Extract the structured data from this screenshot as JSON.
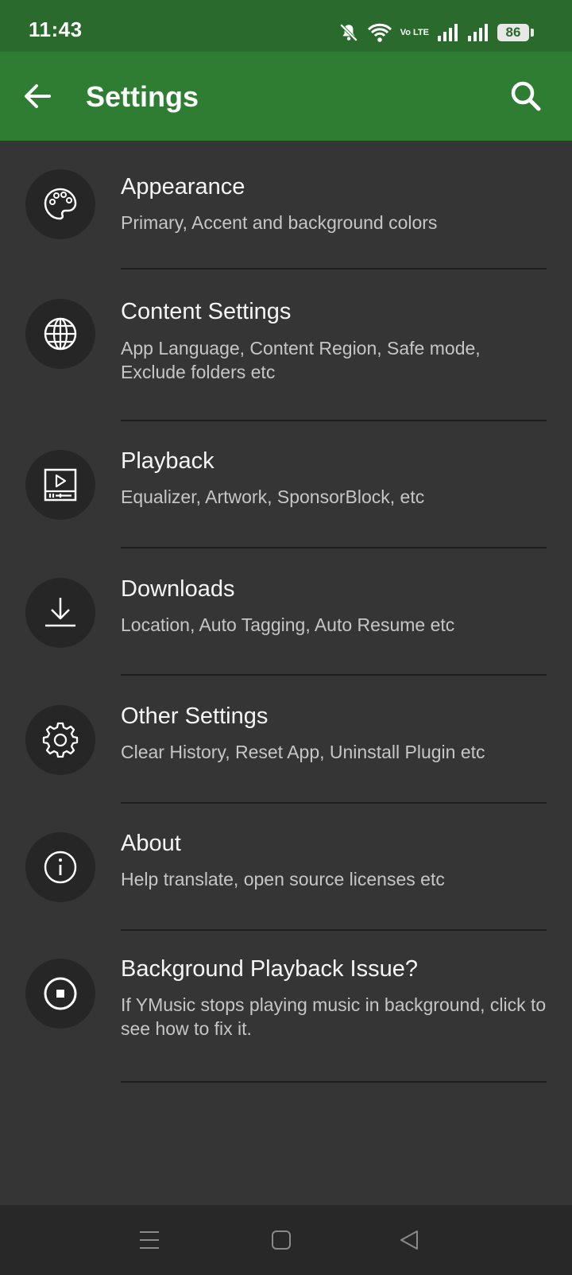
{
  "status_bar": {
    "time": "11:43",
    "network": "Vo LTE",
    "battery": "86",
    "icons": [
      "bell-muted-icon",
      "wifi-icon",
      "volte-icon",
      "signal-icon",
      "signal-icon",
      "battery-icon"
    ]
  },
  "app_bar": {
    "title": "Settings",
    "back_icon": "arrow-back-icon",
    "search_icon": "search-icon"
  },
  "settings": [
    {
      "title": "Appearance",
      "subtitle": "Primary, Accent and background colors",
      "icon": "palette-icon"
    },
    {
      "title": "Content Settings",
      "subtitle": "App Language, Content Region, Safe mode, Exclude folders etc",
      "icon": "globe-icon"
    },
    {
      "title": "Playback",
      "subtitle": "Equalizer, Artwork, SponsorBlock, etc",
      "icon": "playback-icon"
    },
    {
      "title": "Downloads",
      "subtitle": "Location, Auto Tagging, Auto Resume etc",
      "icon": "download-icon"
    },
    {
      "title": "Other Settings",
      "subtitle": "Clear History, Reset App, Uninstall Plugin etc",
      "icon": "gear-icon"
    },
    {
      "title": "About",
      "subtitle": "Help translate, open source licenses etc",
      "icon": "info-icon"
    },
    {
      "title": "Background Playback Issue?",
      "subtitle": "If YMusic stops playing music in background, click to see how to fix it.",
      "icon": "stop-circle-icon"
    }
  ],
  "nav_bar": {
    "icons": [
      "menu-icon",
      "home-icon",
      "back-icon"
    ]
  },
  "colors": {
    "app_bar": "#2e7d32",
    "status_bar": "#2a6a2c",
    "background": "#353535",
    "icon_circle": "#262626",
    "title_text": "#f5f5f5",
    "subtitle_text": "#c6c6c6"
  }
}
